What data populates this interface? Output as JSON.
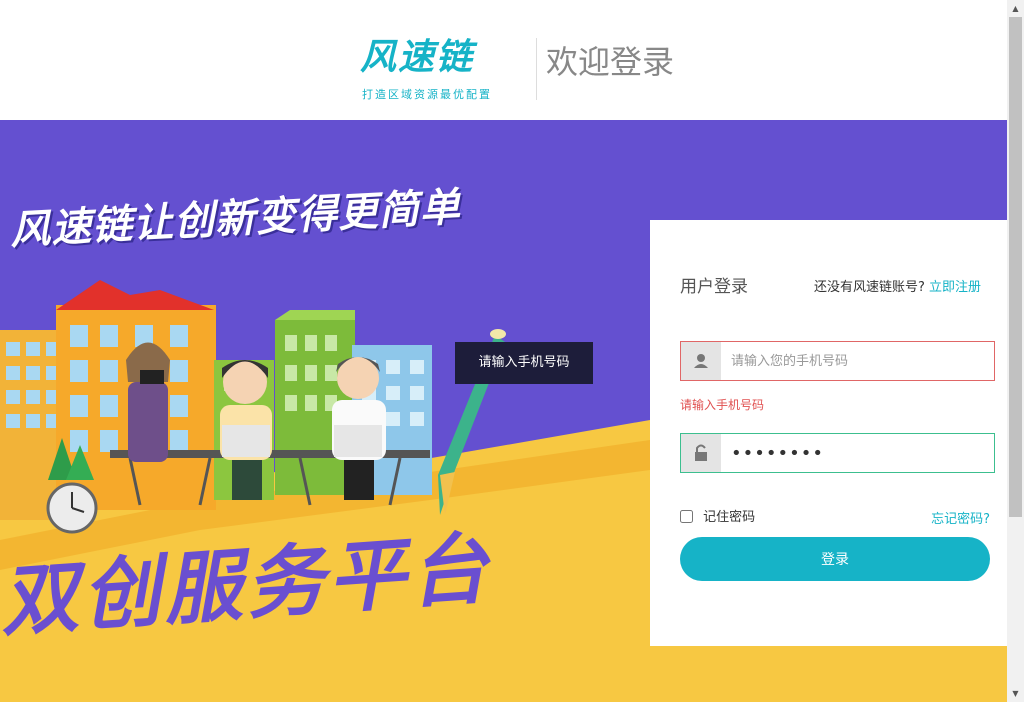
{
  "header": {
    "logo_text": "风速链",
    "logo_tagline": "打造区域资源最优配置",
    "welcome": "欢迎登录"
  },
  "banner": {
    "slogan": "风速链让创新变得更简单",
    "platform": "双创服务平台",
    "tooltip": "请输入手机号码"
  },
  "login": {
    "title": "用户登录",
    "register_prompt": "还没有风速链账号?",
    "register_link": "立即注册",
    "phone_placeholder": "请输入您的手机号码",
    "phone_value": "",
    "phone_error": "请输入手机号码",
    "password_value": "12345678",
    "remember_label": "记住密码",
    "forgot_link": "忘记密码?",
    "submit_label": "登录"
  },
  "colors": {
    "accent": "#16b3c7",
    "banner_purple": "#6450d0",
    "banner_yellow": "#f7c842",
    "error": "#e05050"
  }
}
